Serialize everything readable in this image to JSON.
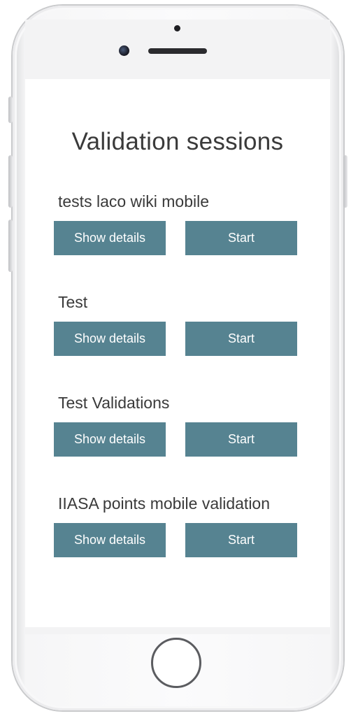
{
  "page": {
    "title": "Validation sessions"
  },
  "sessions": [
    {
      "name": "tests laco wiki mobile",
      "details_label": "Show details",
      "start_label": "Start"
    },
    {
      "name": "Test",
      "details_label": "Show details",
      "start_label": "Start"
    },
    {
      "name": "Test Validations",
      "details_label": "Show details",
      "start_label": "Start"
    },
    {
      "name": "IIASA points mobile validation",
      "details_label": "Show details",
      "start_label": "Start"
    }
  ],
  "colors": {
    "button_background": "#568391",
    "button_text": "#ffffff",
    "text": "#3a3a3a"
  },
  "device": {
    "icons": [
      "front-camera-icon",
      "earpiece-icon",
      "sensor-icon",
      "home-button-icon"
    ]
  }
}
